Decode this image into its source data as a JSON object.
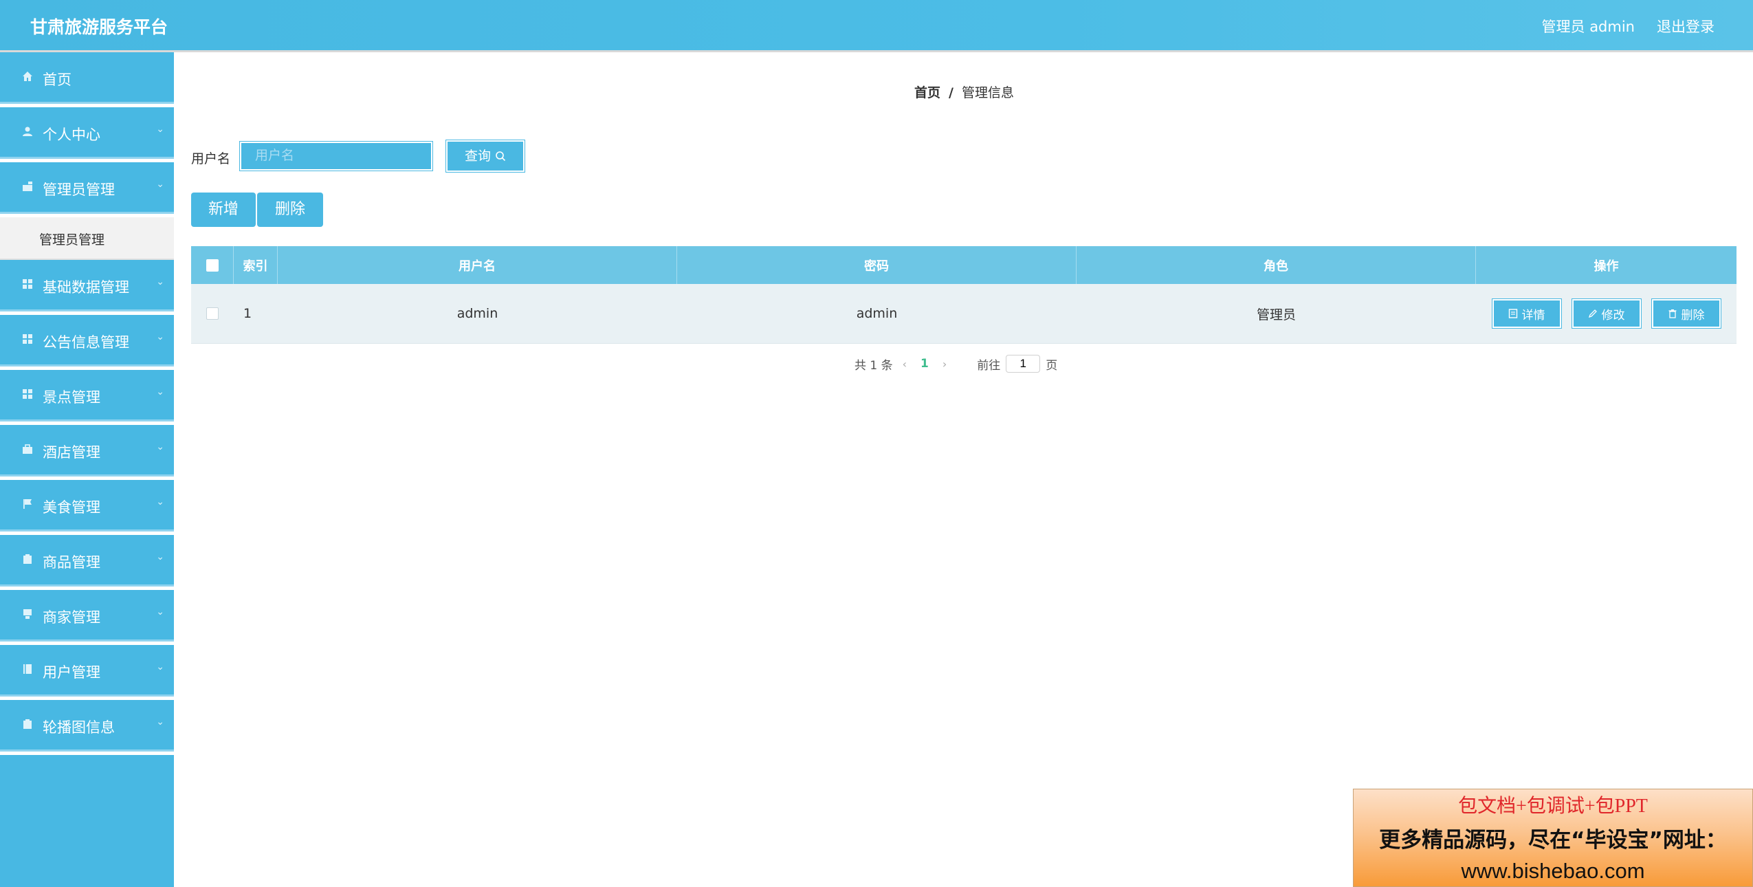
{
  "header": {
    "title": "甘肃旅游服务平台",
    "user_label": "管理员 admin",
    "logout": "退出登录"
  },
  "sidebar": {
    "home": "首页",
    "items": [
      {
        "label": "个人中心",
        "icon": "user-icon"
      },
      {
        "label": "管理员管理",
        "icon": "admin-icon"
      },
      {
        "label": "基础数据管理",
        "icon": "grid-icon"
      },
      {
        "label": "公告信息管理",
        "icon": "grid-icon"
      },
      {
        "label": "景点管理",
        "icon": "grid-icon"
      },
      {
        "label": "酒店管理",
        "icon": "briefcase-icon"
      },
      {
        "label": "美食管理",
        "icon": "flag-icon"
      },
      {
        "label": "商品管理",
        "icon": "clipboard-icon"
      },
      {
        "label": "商家管理",
        "icon": "store-icon"
      },
      {
        "label": "用户管理",
        "icon": "book-icon"
      },
      {
        "label": "轮播图信息",
        "icon": "clipboard-icon"
      }
    ],
    "submenu": "管理员管理"
  },
  "breadcrumb": {
    "home": "首页",
    "sep": "/",
    "current": "管理信息"
  },
  "search": {
    "label": "用户名",
    "placeholder": "用户名",
    "button": "查询"
  },
  "actions": {
    "add": "新增",
    "delete": "删除"
  },
  "table": {
    "headers": [
      "索引",
      "用户名",
      "密码",
      "角色",
      "操作"
    ],
    "rows": [
      {
        "index": "1",
        "username": "admin",
        "password": "admin",
        "role": "管理员"
      }
    ],
    "ops": {
      "detail": "详情",
      "edit": "修改",
      "delete": "删除"
    }
  },
  "pagination": {
    "total": "共 1 条",
    "current": "1",
    "goto": "前往",
    "page_value": "1",
    "page_unit": "页"
  },
  "ad": {
    "line1": "包文档+包调试+包PPT",
    "line2": "更多精品源码，尽在“毕设宝”网址：",
    "line3": "www.bishebao.com"
  }
}
